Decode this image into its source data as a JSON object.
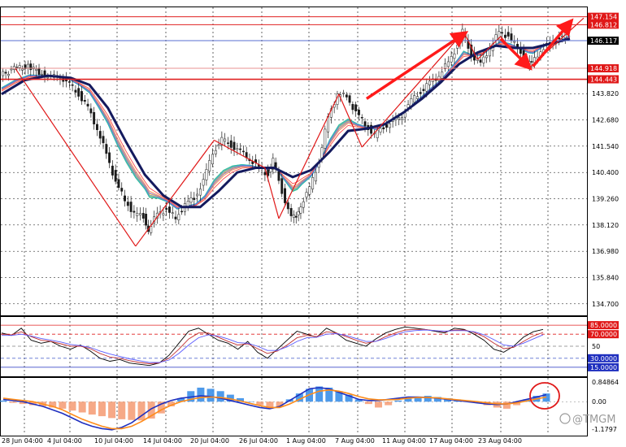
{
  "chart_data": [
    {
      "type": "line",
      "panel": "price",
      "ylim": [
        134.2,
        147.6
      ],
      "x_ticks": [
        "28 Jun 04:00",
        "4 Jul 04:00",
        "10 Jul 04:00",
        "14 Jul 04:00",
        "20 Jul 04:00",
        "26 Jul 04:00",
        "1 Aug 04:00",
        "7 Aug 04:00",
        "11 Aug 04:00",
        "17 Aug 04:00",
        "23 Aug 04:00"
      ],
      "y_ticks": [
        143.82,
        142.68,
        141.54,
        140.4,
        139.26,
        138.12,
        136.98,
        135.84,
        134.7
      ],
      "levels": [
        {
          "value": 147.154,
          "label": "147.154",
          "color": "#e02020",
          "style": "solid"
        },
        {
          "value": 146.812,
          "label": "146.812",
          "color": "#e02020",
          "style": "solid"
        },
        {
          "value": 146.117,
          "label": "146.117",
          "color": "#5a6fd0",
          "style": "solid"
        },
        {
          "value": 144.918,
          "label": "144.918",
          "color": "#e89090",
          "style": "solid"
        },
        {
          "value": 144.443,
          "label": "144.443",
          "color": "#e02020",
          "style": "solid"
        }
      ],
      "price_path": [
        [
          0,
          144.6
        ],
        [
          3,
          144.9
        ],
        [
          6,
          145.0
        ],
        [
          9,
          144.7
        ],
        [
          11,
          144.5
        ],
        [
          13,
          144.6
        ],
        [
          15,
          144.2
        ],
        [
          17,
          143.8
        ],
        [
          19,
          143.2
        ],
        [
          21,
          142.3
        ],
        [
          23,
          141.2
        ],
        [
          25,
          140.0
        ],
        [
          27,
          139.2
        ],
        [
          29,
          138.6
        ],
        [
          31,
          138.5
        ],
        [
          32,
          137.9
        ],
        [
          34,
          138.6
        ],
        [
          36,
          138.8
        ],
        [
          38,
          138.4
        ],
        [
          40,
          139.0
        ],
        [
          42,
          139.3
        ],
        [
          44,
          140.0
        ],
        [
          46,
          141.3
        ],
        [
          48,
          141.8
        ],
        [
          50,
          141.6
        ],
        [
          52,
          141.3
        ],
        [
          54,
          141.0
        ],
        [
          56,
          140.6
        ],
        [
          58,
          140.3
        ],
        [
          59,
          140.9
        ],
        [
          61,
          139.6
        ],
        [
          63,
          138.4
        ],
        [
          64,
          138.5
        ],
        [
          65,
          139.0
        ],
        [
          67,
          139.7
        ],
        [
          69,
          140.9
        ],
        [
          71,
          142.8
        ],
        [
          73,
          143.8
        ],
        [
          75,
          143.7
        ],
        [
          77,
          143.0
        ],
        [
          79,
          142.5
        ],
        [
          81,
          142.0
        ],
        [
          83,
          142.4
        ],
        [
          85,
          142.6
        ],
        [
          87,
          142.9
        ],
        [
          89,
          143.5
        ],
        [
          91,
          143.9
        ],
        [
          93,
          144.3
        ],
        [
          95,
          144.6
        ],
        [
          97,
          145.2
        ],
        [
          99,
          145.9
        ],
        [
          100,
          146.5
        ],
        [
          102,
          145.5
        ],
        [
          104,
          145.1
        ],
        [
          106,
          145.8
        ],
        [
          108,
          146.5
        ],
        [
          110,
          146.3
        ],
        [
          112,
          145.8
        ],
        [
          114,
          145.2
        ],
        [
          115,
          145.1
        ],
        [
          117,
          145.7
        ],
        [
          119,
          146.0
        ],
        [
          121,
          146.2
        ],
        [
          123,
          146.6
        ]
      ],
      "ma_path": [
        [
          0,
          143.8
        ],
        [
          5,
          144.4
        ],
        [
          10,
          144.6
        ],
        [
          15,
          144.5
        ],
        [
          19,
          144.2
        ],
        [
          23,
          143.2
        ],
        [
          27,
          141.7
        ],
        [
          31,
          140.3
        ],
        [
          35,
          139.4
        ],
        [
          39,
          138.9
        ],
        [
          43,
          138.9
        ],
        [
          47,
          139.6
        ],
        [
          51,
          140.4
        ],
        [
          55,
          140.6
        ],
        [
          59,
          140.6
        ],
        [
          63,
          140.2
        ],
        [
          67,
          140.5
        ],
        [
          71,
          141.3
        ],
        [
          75,
          142.2
        ],
        [
          79,
          142.3
        ],
        [
          83,
          142.5
        ],
        [
          87,
          143.0
        ],
        [
          91,
          143.6
        ],
        [
          95,
          144.3
        ],
        [
          99,
          145.1
        ],
        [
          103,
          145.6
        ],
        [
          107,
          145.9
        ],
        [
          111,
          145.8
        ],
        [
          115,
          145.8
        ],
        [
          119,
          146.0
        ],
        [
          123,
          146.2
        ]
      ],
      "annotation_lines": [
        [
          [
            3,
            144.9
          ],
          [
            29,
            137.2
          ]
        ],
        [
          [
            29,
            137.2
          ],
          [
            46,
            141.8
          ]
        ],
        [
          [
            46,
            141.8
          ],
          [
            57,
            140.6
          ]
        ],
        [
          [
            57,
            140.6
          ],
          [
            60,
            138.4
          ]
        ],
        [
          [
            60,
            138.4
          ],
          [
            73,
            143.8
          ]
        ],
        [
          [
            73,
            143.8
          ],
          [
            78,
            141.5
          ]
        ],
        [
          [
            78,
            141.5
          ],
          [
            100,
            146.5
          ]
        ],
        [
          [
            100,
            146.5
          ],
          [
            103,
            145.3
          ]
        ],
        [
          [
            103,
            145.3
          ],
          [
            108,
            146.3
          ]
        ],
        [
          [
            108,
            146.3
          ],
          [
            114,
            144.9
          ]
        ],
        [
          [
            114,
            144.9
          ],
          [
            126,
            147.1
          ]
        ]
      ],
      "arrows": [
        [
          [
            79,
            143.6
          ],
          [
            100,
            146.4
          ]
        ],
        [
          [
            108,
            146.2
          ],
          [
            114,
            145.0
          ]
        ],
        [
          [
            115,
            145.0
          ],
          [
            123,
            146.9
          ]
        ]
      ]
    },
    {
      "type": "line",
      "panel": "stochastic",
      "ylim": [
        0,
        100
      ],
      "levels": [
        {
          "value": 85,
          "label": "85.0000",
          "color": "#e02020",
          "style": "solid"
        },
        {
          "value": 70,
          "label": "70.0000",
          "color": "#e02020",
          "style": "dash"
        },
        {
          "value": 50,
          "label": "50",
          "color": "#808080",
          "style": "dash"
        },
        {
          "value": 30,
          "label": "30.0000",
          "color": "#5a6fd0",
          "style": "dash"
        },
        {
          "value": 15,
          "label": "15.0000",
          "color": "#1f2fbf",
          "style": "solid"
        }
      ],
      "series": [
        {
          "color": "#000000",
          "values": [
            72,
            68,
            80,
            60,
            55,
            58,
            50,
            45,
            52,
            42,
            30,
            25,
            28,
            22,
            20,
            18,
            22,
            35,
            55,
            75,
            80,
            70,
            60,
            55,
            45,
            58,
            40,
            30,
            45,
            60,
            75,
            70,
            65,
            80,
            72,
            60,
            55,
            50,
            62,
            72,
            78,
            82,
            80,
            78,
            75,
            72,
            80,
            78,
            70,
            60,
            45,
            40,
            50,
            65,
            74,
            78
          ]
        },
        {
          "color": "#c03030",
          "values": [
            70,
            69,
            74,
            66,
            60,
            58,
            54,
            50,
            50,
            46,
            38,
            32,
            30,
            26,
            23,
            21,
            22,
            30,
            45,
            62,
            72,
            72,
            65,
            58,
            52,
            54,
            46,
            38,
            42,
            52,
            64,
            68,
            66,
            74,
            72,
            66,
            60,
            55,
            58,
            66,
            72,
            77,
            78,
            78,
            76,
            74,
            77,
            77,
            73,
            66,
            55,
            46,
            48,
            58,
            67,
            73
          ]
        },
        {
          "color": "#5a5aff",
          "values": [
            68,
            68,
            70,
            67,
            63,
            60,
            57,
            53,
            51,
            48,
            42,
            37,
            33,
            29,
            26,
            23,
            23,
            27,
            38,
            52,
            64,
            69,
            67,
            62,
            56,
            55,
            50,
            43,
            43,
            49,
            58,
            64,
            65,
            70,
            71,
            68,
            63,
            58,
            58,
            63,
            69,
            74,
            76,
            77,
            76,
            75,
            76,
            76,
            74,
            69,
            61,
            52,
            50,
            55,
            62,
            69
          ]
        }
      ]
    },
    {
      "type": "bar",
      "panel": "macd",
      "ylim": [
        -1.45,
        1.05
      ],
      "levels": [
        {
          "value": 0.84864,
          "label": "0.84864",
          "color": "#808080",
          "style": "none"
        },
        {
          "value": 0.0,
          "label": "0.00",
          "color": "#808080",
          "style": "dash"
        },
        {
          "value": -1.1797,
          "label": "-1.1797",
          "color": "#808080",
          "style": "none"
        }
      ],
      "histogram": [
        0.05,
        -0.05,
        -0.1,
        -0.15,
        -0.2,
        -0.25,
        -0.3,
        -0.38,
        -0.46,
        -0.55,
        -0.62,
        -0.7,
        -0.75,
        -0.78,
        -0.8,
        -0.72,
        -0.5,
        -0.2,
        0.15,
        0.45,
        0.6,
        0.55,
        0.45,
        0.3,
        0.15,
        0.0,
        -0.15,
        -0.3,
        -0.2,
        0.1,
        0.35,
        0.55,
        0.65,
        0.6,
        0.45,
        0.3,
        0.1,
        -0.1,
        -0.25,
        -0.15,
        0.05,
        0.15,
        0.2,
        0.25,
        0.2,
        0.15,
        0.1,
        0.05,
        -0.05,
        -0.15,
        -0.25,
        -0.3,
        -0.15,
        0.1,
        0.25,
        0.35
      ],
      "series": [
        {
          "color": "#1f2fbf",
          "values": [
            0.1,
            0.05,
            0.0,
            -0.1,
            -0.2,
            -0.35,
            -0.5,
            -0.7,
            -0.9,
            -1.05,
            -1.15,
            -1.2,
            -1.1,
            -0.9,
            -0.6,
            -0.3,
            -0.1,
            0.05,
            0.15,
            0.2,
            0.25,
            0.22,
            0.15,
            0.05,
            -0.05,
            -0.15,
            -0.25,
            -0.3,
            -0.2,
            0.05,
            0.3,
            0.55,
            0.6,
            0.55,
            0.4,
            0.25,
            0.1,
            0.05,
            0.05,
            0.1,
            0.15,
            0.2,
            0.2,
            0.18,
            0.15,
            0.1,
            0.05,
            0.0,
            -0.05,
            -0.1,
            -0.12,
            -0.1,
            0.0,
            0.1,
            0.2,
            0.3
          ]
        },
        {
          "color": "#ff8c1a",
          "values": [
            0.15,
            0.1,
            0.05,
            0.0,
            -0.1,
            -0.2,
            -0.35,
            -0.55,
            -0.75,
            -0.9,
            -1.05,
            -1.15,
            -1.15,
            -1.05,
            -0.85,
            -0.6,
            -0.35,
            -0.15,
            0.0,
            0.1,
            0.18,
            0.2,
            0.18,
            0.12,
            0.03,
            -0.07,
            -0.17,
            -0.25,
            -0.25,
            -0.1,
            0.1,
            0.3,
            0.45,
            0.5,
            0.45,
            0.35,
            0.22,
            0.12,
            0.08,
            0.08,
            0.1,
            0.15,
            0.18,
            0.18,
            0.16,
            0.12,
            0.08,
            0.04,
            0.0,
            -0.05,
            -0.09,
            -0.1,
            -0.05,
            0.03,
            0.12,
            0.2
          ]
        }
      ]
    }
  ],
  "watermark": "@TMGM"
}
